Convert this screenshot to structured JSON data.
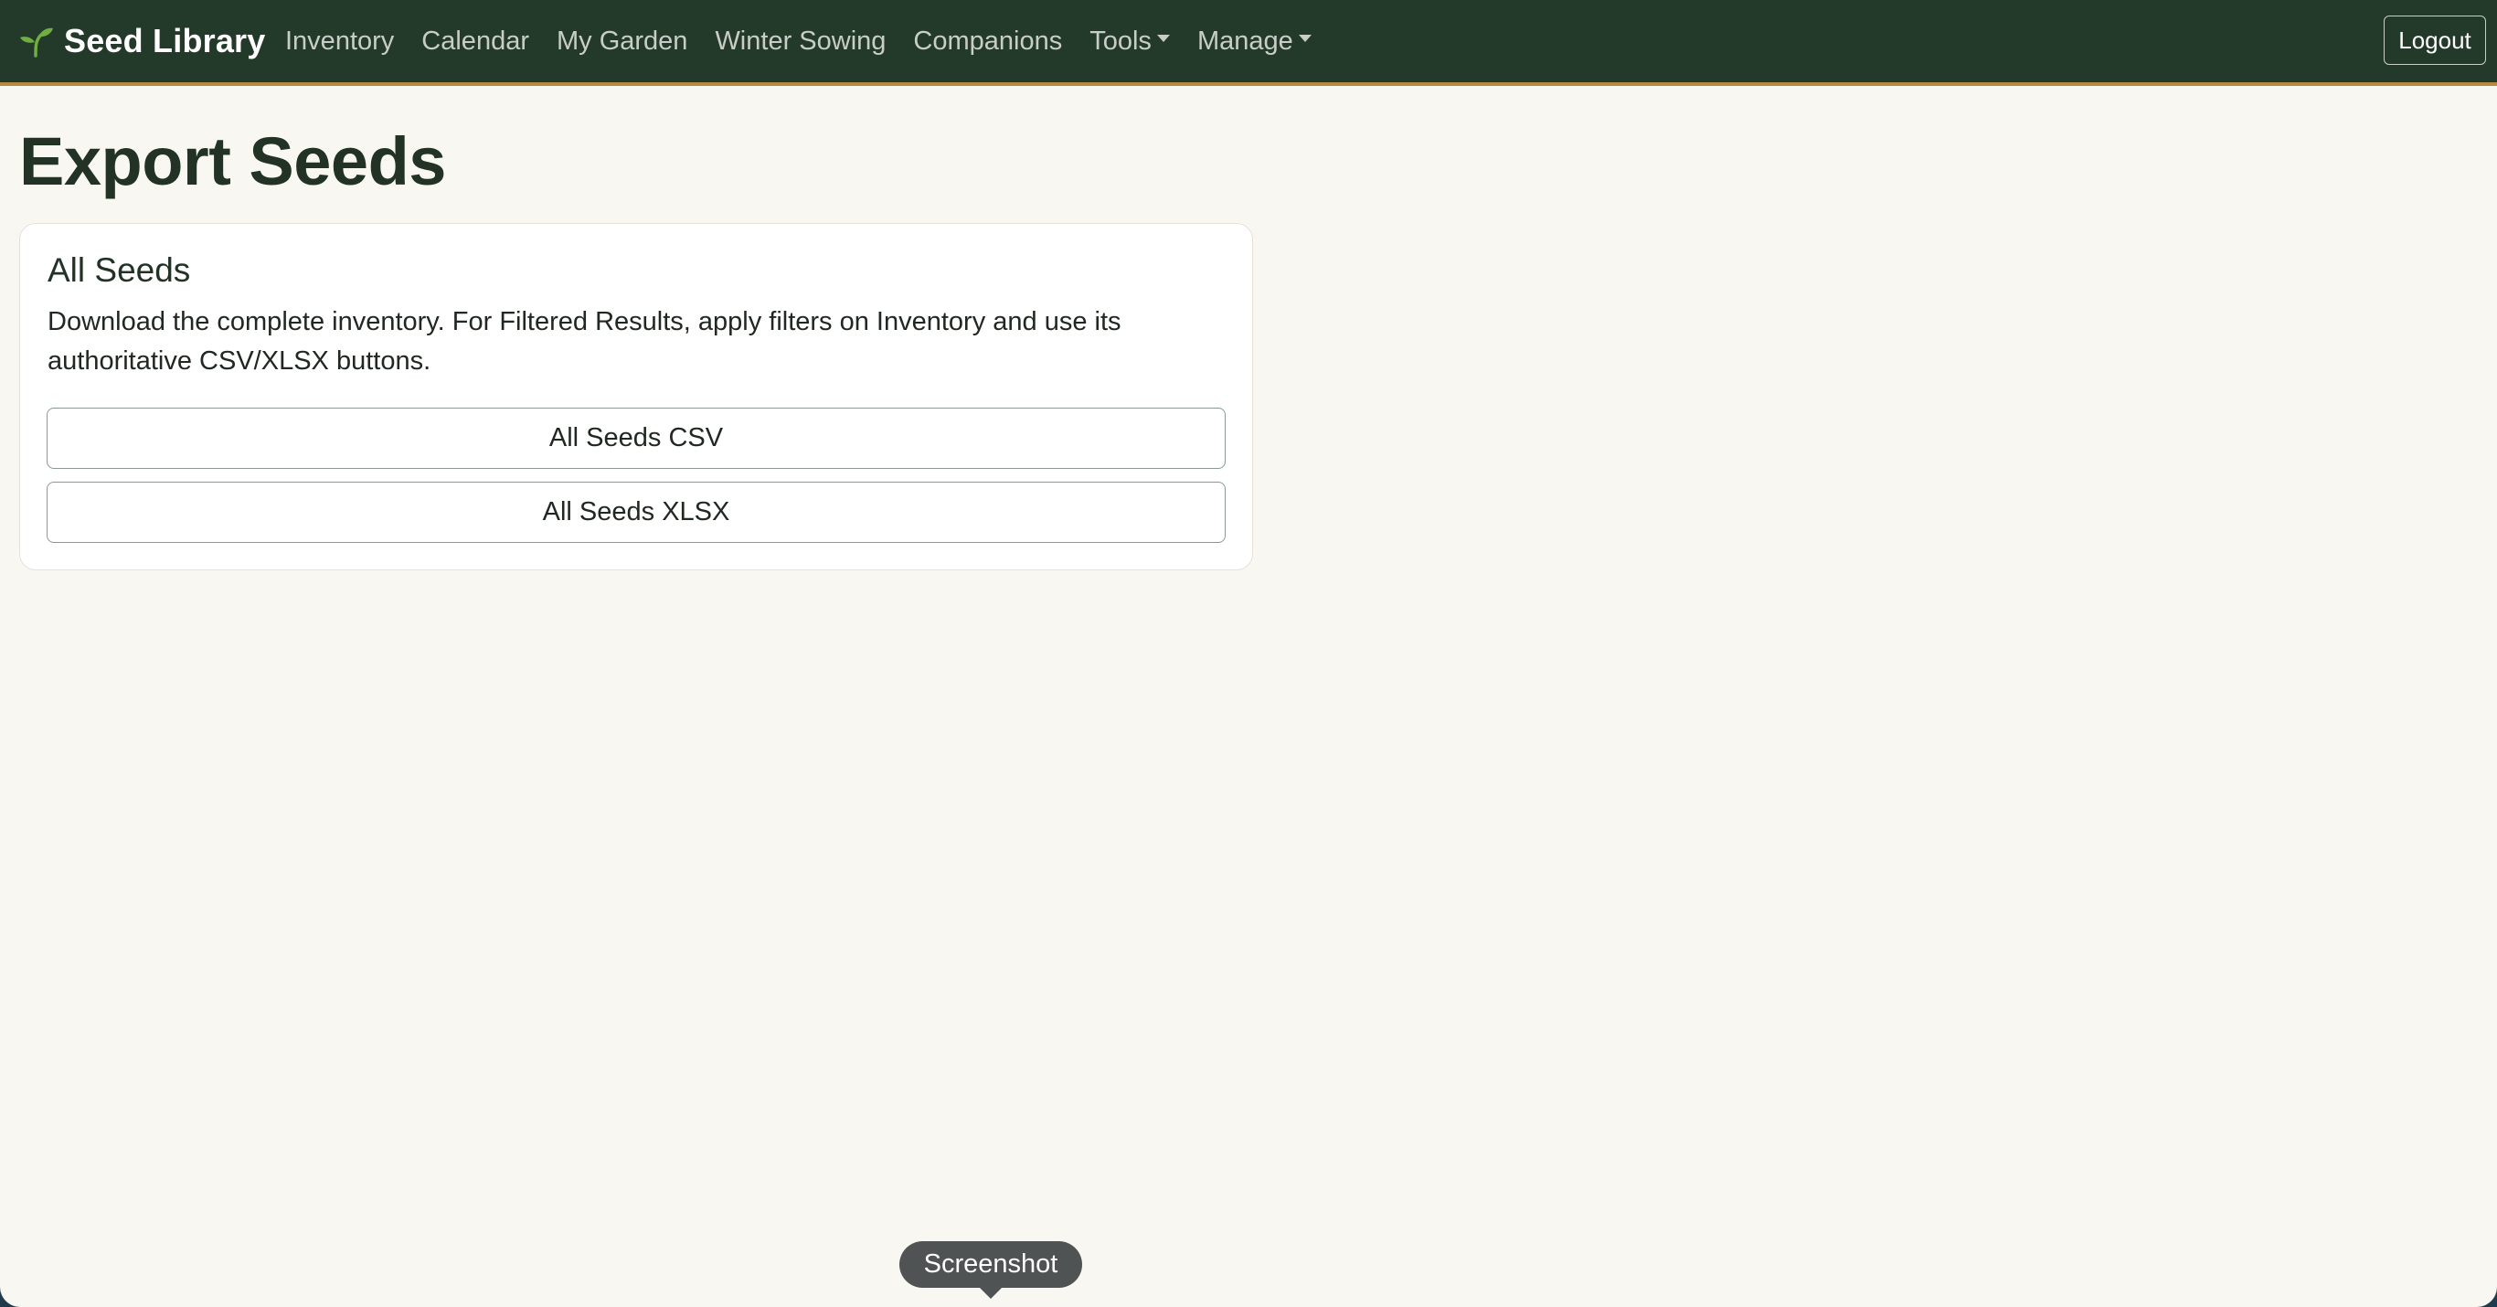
{
  "navbar": {
    "brand": "Seed Library",
    "brand_icon": "seedling-icon",
    "links": [
      {
        "label": "Inventory"
      },
      {
        "label": "Calendar"
      },
      {
        "label": "My Garden"
      },
      {
        "label": "Winter Sowing"
      },
      {
        "label": "Companions"
      },
      {
        "label": "Tools",
        "dropdown": true
      },
      {
        "label": "Manage",
        "dropdown": true
      }
    ],
    "logout_label": "Logout"
  },
  "main": {
    "title": "Export Seeds",
    "card": {
      "title": "All Seeds",
      "description": "Download the complete inventory. For Filtered Results, apply filters on Inventory and use its authoritative CSV/XLSX buttons.",
      "csv_button": "All Seeds CSV",
      "xlsx_button": "All Seeds XLSX"
    }
  },
  "tooltip": {
    "label": "Screenshot"
  },
  "colors": {
    "navbar_bg": "#233a2b",
    "navbar_accent": "#b88a3e",
    "page_bg": "#f9f7f1",
    "brand_icon": "#6fae3f"
  }
}
